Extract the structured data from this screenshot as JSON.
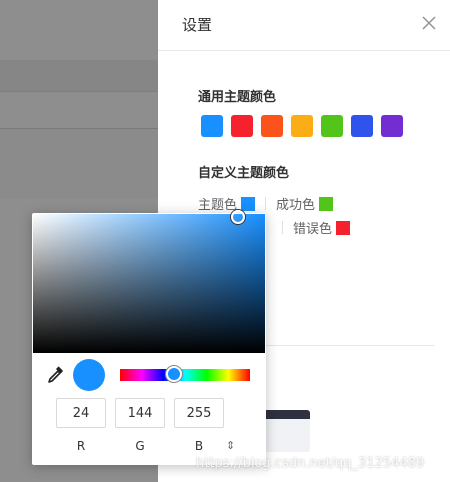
{
  "drawer": {
    "title": "设置",
    "common_theme_title": "通用主题颜色",
    "custom_theme_title": "自定义主题颜色",
    "common_colors": [
      "#1890ff",
      "#f5222d",
      "#fa541c",
      "#faad14",
      "#52c41a",
      "#2f54eb",
      "#722ed1"
    ],
    "custom": {
      "primary_label": "主题色",
      "primary_color": "#1890ff",
      "success_label": "成功色",
      "success_color": "#52c41a",
      "error_label": "错误色",
      "error_color": "#f5222d"
    }
  },
  "picker": {
    "current_color": "#1890ff",
    "r": "24",
    "g": "144",
    "b": "255",
    "r_label": "R",
    "g_label": "G",
    "b_label": "B",
    "mode_icon": "up-down-arrows-icon"
  },
  "watermark": "https://blog.csdn.net/qq_31254489"
}
